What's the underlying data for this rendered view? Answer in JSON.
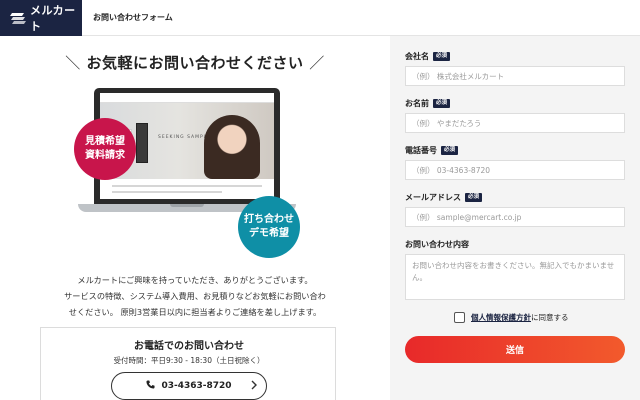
{
  "header": {
    "logo_text": "メルカート",
    "title": "お問い合わせフォーム",
    "brand_color": "#1b2442"
  },
  "main": {
    "headline": "お気軽にお問い合わせください",
    "headline_slash_left": "＼",
    "headline_slash_right": "／",
    "illustration": {
      "hero_text": "SEEKING SAMPLE SHOP",
      "badge_red_line1": "見積希望",
      "badge_red_line2": "資料請求",
      "badge_teal_line1": "打ち合わせ",
      "badge_teal_line2": "デモ希望",
      "badge_red_color": "#c8154b",
      "badge_teal_color": "#0f8fa6"
    },
    "intro_line1": "メルカートにご興味を持っていただき、ありがとうございます。",
    "intro_line2": "サービスの特徴、システム導入費用、お見積りなどお気軽にお問い合わ",
    "intro_line3": "せください。 原則3営業日以内に担当者よりご連絡を差し上げます。",
    "contact": {
      "title": "お電話でのお問い合わせ",
      "hours": "受付時間：平日9:30 - 18:30（土日祝除く）",
      "phone": "03-4363-8720",
      "phone_icon": "phone-icon",
      "chevron_icon": "chevron-right-icon"
    }
  },
  "form": {
    "required_label": "必須",
    "company": {
      "label": "会社名",
      "placeholder": "（例） 株式会社メルカート",
      "value": ""
    },
    "name": {
      "label": "お名前",
      "placeholder": "（例） やまだたろう",
      "value": ""
    },
    "phone": {
      "label": "電話番号",
      "placeholder": "（例） 03-4363-8720",
      "value": ""
    },
    "email": {
      "label": "メールアドレス",
      "placeholder": "（例） sample@mercart.co.jp",
      "value": ""
    },
    "message": {
      "label": "お問い合わせ内容",
      "placeholder": "お問い合わせ内容をお書きください。無記入でもかまいません。",
      "value": ""
    },
    "agree_link": "個人情報保護方針",
    "agree_suffix": "に同意する",
    "agree_checked": false,
    "submit_label": "送信",
    "submit_color_start": "#e8292a",
    "submit_color_end": "#f25a2c"
  }
}
